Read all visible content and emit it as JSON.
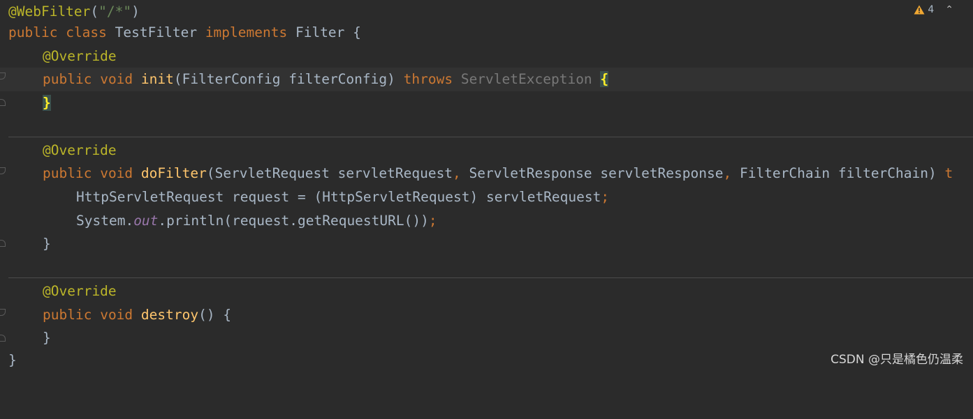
{
  "editor": {
    "lines": {
      "l1": {
        "annotation": "@WebFilter",
        "open_paren": "(",
        "string": "\"/*\"",
        "close_paren": ")"
      },
      "l2": {
        "kw_public": "public",
        "kw_class": "class",
        "class_name": "TestFilter",
        "kw_implements": "implements",
        "iface": "Filter",
        "brace": "{"
      },
      "l3": {
        "annotation": "@Override"
      },
      "l4": {
        "kw_public": "public",
        "kw_void": "void",
        "method": "init",
        "params": "(FilterConfig filterConfig)",
        "kw_throws": "throws",
        "exception": "ServletException",
        "brace": "{"
      },
      "l5": {
        "brace": "}"
      },
      "l7": {
        "annotation": "@Override"
      },
      "l8": {
        "kw_public": "public",
        "kw_void": "void",
        "method": "doFilter",
        "p1": "(ServletRequest servletRequest",
        "c1": ",",
        "p2": " ServletResponse servletResponse",
        "c2": ",",
        "p3": " FilterChain filterChain) ",
        "tail": "t"
      },
      "l9": {
        "text": "HttpServletRequest request = (HttpServletRequest) servletRequest",
        "semi": ";"
      },
      "l10": {
        "pre": "System.",
        "field": "out",
        "post": ".println(request.getRequestURL())",
        "semi": ";"
      },
      "l11": {
        "brace": "}"
      },
      "l13": {
        "annotation": "@Override"
      },
      "l14": {
        "kw_public": "public",
        "kw_void": "void",
        "method": "destroy",
        "rest": "() {"
      },
      "l15": {
        "brace": "}"
      },
      "l16": {
        "brace": "}"
      }
    }
  },
  "inspections": {
    "warning_count": "4",
    "warning_icon": "warning-triangle-icon",
    "chevron_icon": "chevron-up-icon"
  },
  "watermark": {
    "text": "CSDN @只是橘色仍温柔"
  },
  "colors": {
    "background": "#2b2b2b",
    "keyword": "#cc7832",
    "annotation": "#bbb529",
    "function": "#ffc66d",
    "string": "#6a8759",
    "text": "#a9b7c6",
    "static_field": "#9876aa",
    "warning": "#f0a732"
  }
}
